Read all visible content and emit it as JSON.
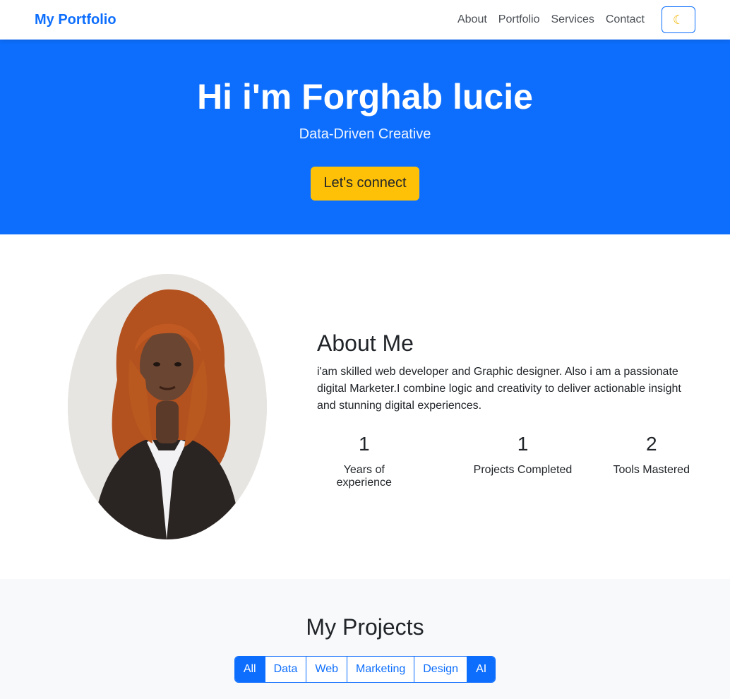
{
  "navbar": {
    "brand": "My Portfolio",
    "links": [
      "About",
      "Portfolio",
      "Services",
      "Contact"
    ],
    "theme_icon": "moon-icon"
  },
  "hero": {
    "title": "Hi i'm Forghab lucie",
    "subtitle": "Data-Driven Creative",
    "cta_label": "Let's connect"
  },
  "about": {
    "heading": "About Me",
    "text": "i'am skilled web developer and Graphic designer. Also i am a passionate digital Marketer.I combine logic and creativity to deliver actionable insight and stunning digital experiences.",
    "stats": [
      {
        "value": "1",
        "label": "Years of experience"
      },
      {
        "value": "1",
        "label": "Projects Completed"
      },
      {
        "value": "2",
        "label": "Tools Mastered"
      }
    ]
  },
  "projects": {
    "heading": "My Projects",
    "filters": [
      "All",
      "Data",
      "Web",
      "Marketing",
      "Design",
      "AI"
    ],
    "active_filter": "All"
  },
  "colors": {
    "primary": "#0d6efd",
    "accent": "#ffc107"
  }
}
